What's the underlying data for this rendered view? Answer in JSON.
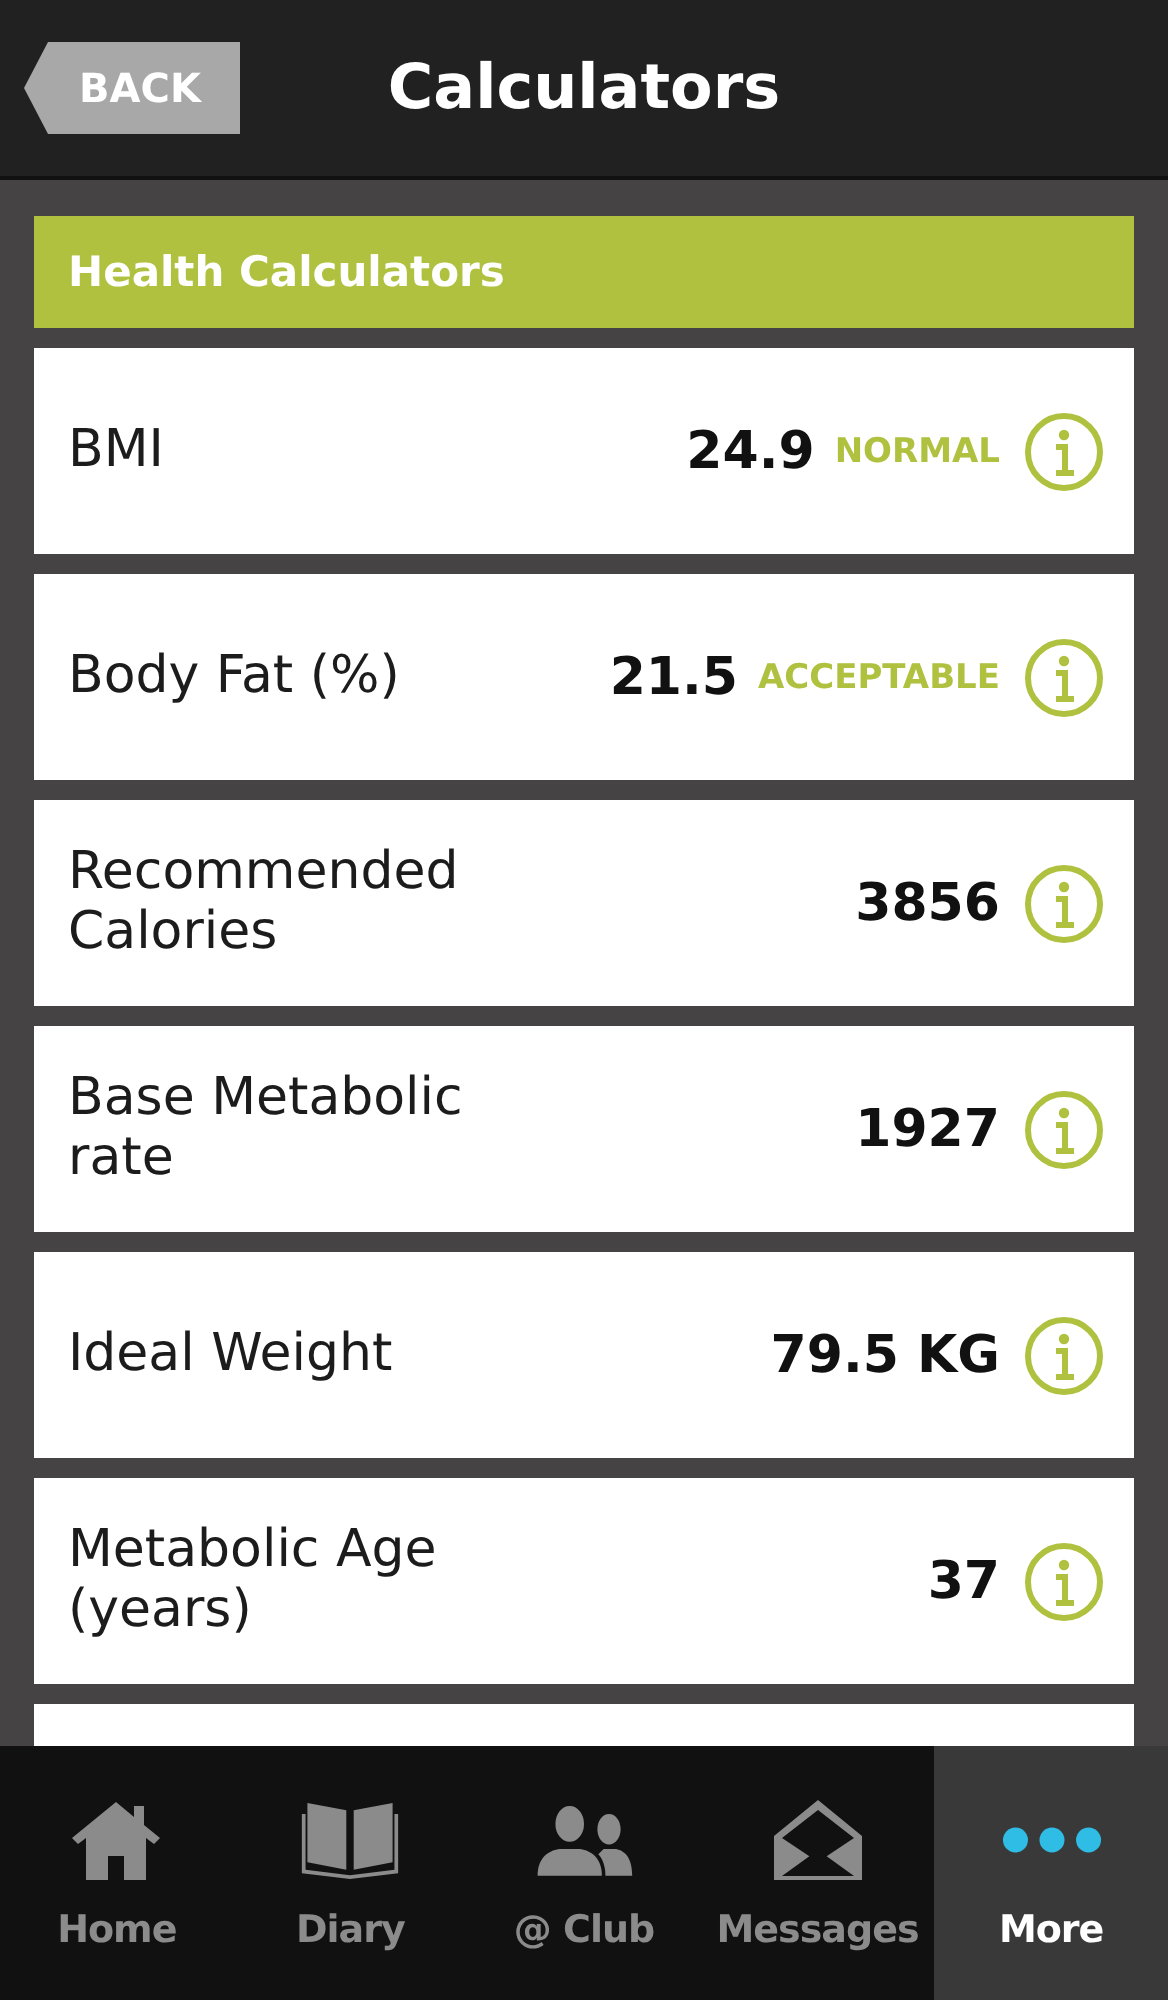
{
  "header": {
    "back": "BACK",
    "title": "Calculators"
  },
  "section": {
    "title": "Health Calculators"
  },
  "rows": [
    {
      "label": "BMI",
      "value": "24.9",
      "status": "NORMAL"
    },
    {
      "label": "Body Fat (%)",
      "value": "21.5",
      "status": "ACCEPTABLE"
    },
    {
      "label": "Recommended Calories",
      "value": "3856"
    },
    {
      "label": "Base Metabolic rate",
      "value": "1927"
    },
    {
      "label": "Ideal Weight",
      "value": "79.5 KG"
    },
    {
      "label": "Metabolic Age (years)",
      "value": "37"
    }
  ],
  "nav": [
    {
      "kind": "home",
      "label": "Home",
      "selected": false
    },
    {
      "kind": "diary",
      "label": "Diary",
      "selected": false
    },
    {
      "kind": "club",
      "label": "@ Club",
      "selected": false
    },
    {
      "kind": "messages",
      "label": "Messages",
      "selected": false
    },
    {
      "kind": "more",
      "label": "More",
      "selected": true
    }
  ]
}
